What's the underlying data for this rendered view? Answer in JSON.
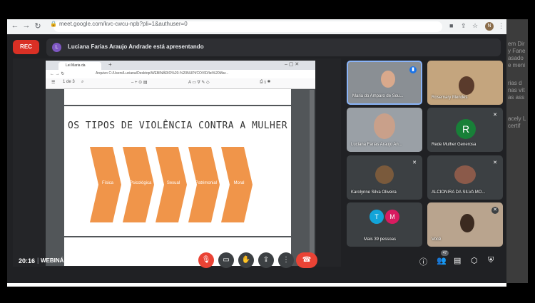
{
  "browser": {
    "url": "meet.google.com/kvc-cwcu-npb?pli=1&authuser=0",
    "avatar_letter": "N"
  },
  "meet": {
    "rec_label": "REC",
    "presenter_initial": "L",
    "presenter_text": "Luciana Farias Araujo Andrade está apresentando",
    "clock": "20:16",
    "meeting_title": "WEBINÁRIO L EI MARIA DA PENHA: AVANÇOS...",
    "participants_count": "47"
  },
  "pdf": {
    "tab_title": "Lei Maria da Penha.pdf",
    "address": "Arquivo   C:/Users/Luciana/Desktop/WEBINÁRIO%20-%20NUPI/COVID/lei%20Mar...",
    "page_indicator": "1 de 3"
  },
  "slide": {
    "title": "OS TIPOS DE VIOLÊNCIA CONTRA A MULHER",
    "types": [
      "Física",
      "Psicológica",
      "Sexual",
      "Patrimonial",
      "Moral"
    ],
    "color": "#f0954a"
  },
  "tiles": [
    {
      "name": "Maria do Amparo de Sou...",
      "highlighted": true
    },
    {
      "name": "Rosemary Mendes"
    },
    {
      "name": "Luciana Farias Araujo An..."
    },
    {
      "name": "Rede Mulher Generosa",
      "initial": "R"
    },
    {
      "name": "Karolynne Silva Oliveira"
    },
    {
      "name": "ALCIONIRA DA SILVA MO..."
    },
    {
      "name": "Mais 39 pessoas",
      "initials": [
        "T",
        "M"
      ]
    },
    {
      "name": "Você"
    }
  ],
  "side_text": [
    "em Dir",
    "y Fane",
    "asado",
    "e meni",
    "",
    "rias d",
    "nas vít",
    "as ass",
    "",
    "acely L",
    "certif"
  ],
  "colors": {
    "end_call": "#ea4335",
    "accent_blue": "#8ab4f8",
    "meet_bg": "#202124"
  }
}
